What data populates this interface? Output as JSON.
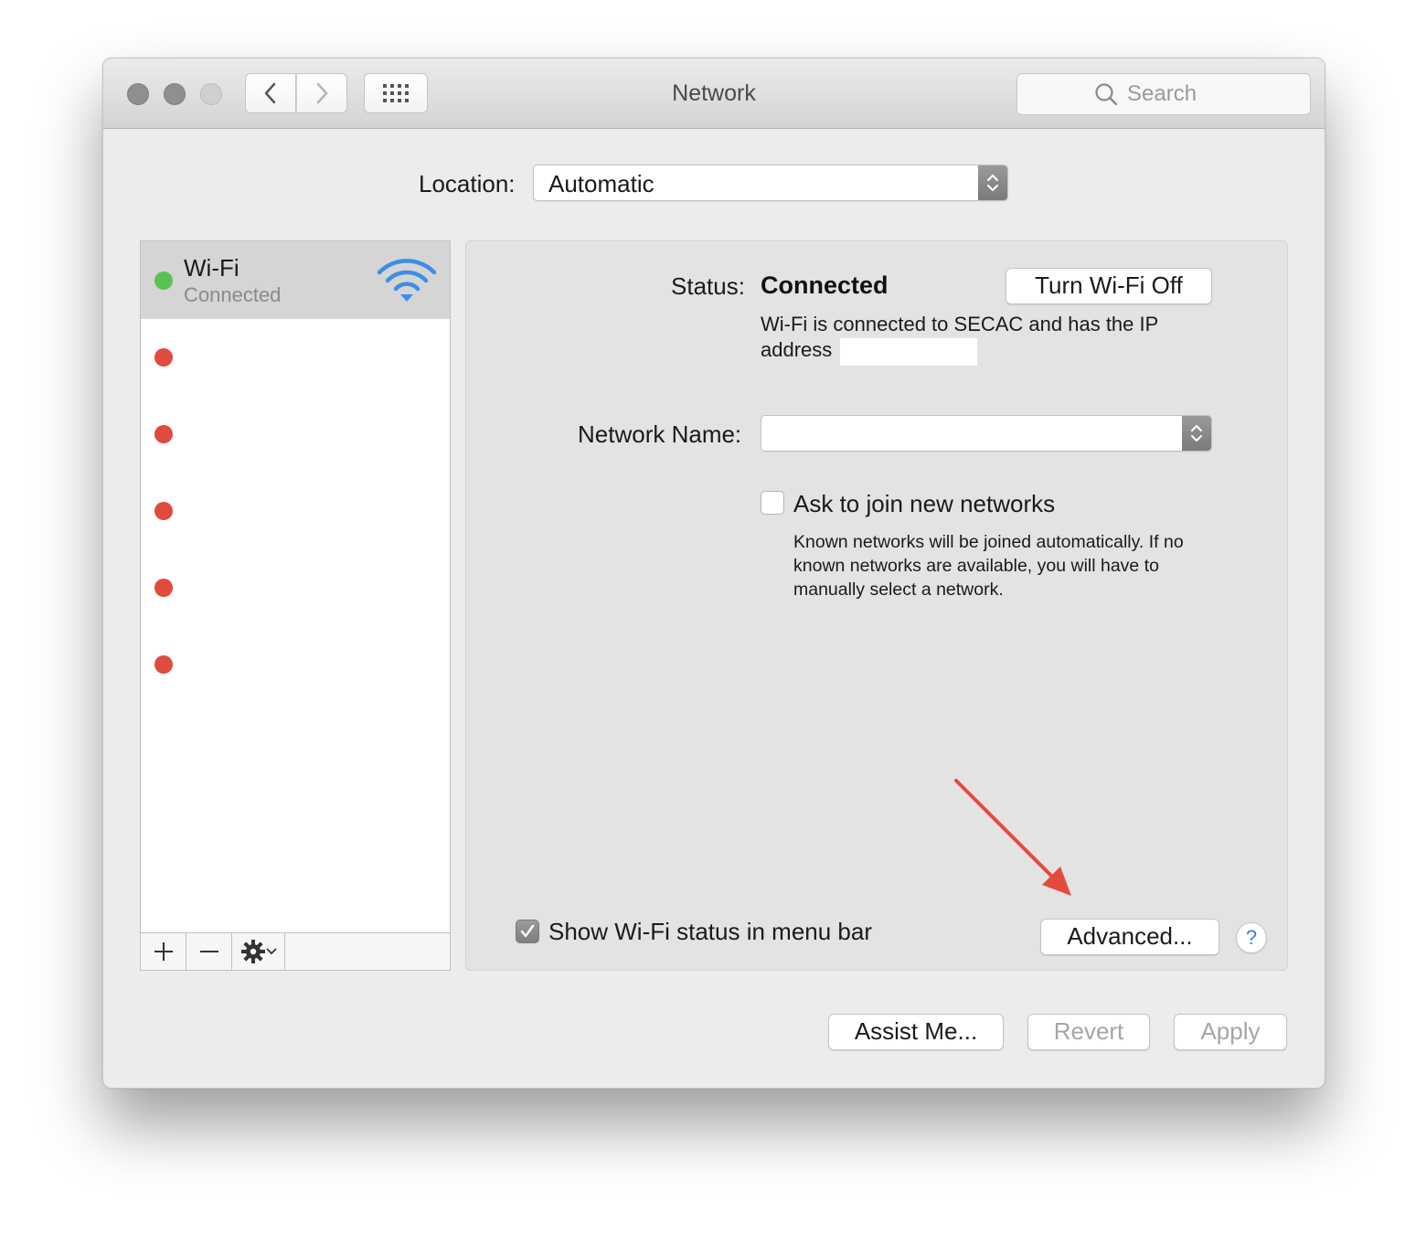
{
  "window": {
    "title": "Network"
  },
  "toolbar": {
    "search_placeholder": "Search",
    "back_icon": "chevron-left-icon",
    "forward_icon": "chevron-right-icon",
    "show_all_icon": "grid-icon"
  },
  "location": {
    "label": "Location:",
    "value": "Automatic"
  },
  "services": {
    "selected": {
      "name": "Wi-Fi",
      "status": "Connected",
      "status_color": "#5ac251"
    },
    "other_status_color": "#e04b3f",
    "other_count_visible": 5
  },
  "sidebar_footer": {
    "add_label": "+",
    "remove_label": "—"
  },
  "detail": {
    "status_label": "Status:",
    "status_value": "Connected",
    "turn_off_label": "Turn Wi-Fi Off",
    "status_description": "Wi-Fi is connected to SECAC and has the IP address",
    "network_name_label": "Network Name:",
    "network_name_value": "",
    "ask_to_join_label": "Ask to join new networks",
    "ask_to_join_checked": false,
    "ask_to_join_description": "Known networks will be joined automatically. If no known networks are available, you will have to manually select a network.",
    "show_status_label": "Show Wi-Fi status in menu bar",
    "show_status_checked": true,
    "advanced_label": "Advanced...",
    "help_label": "?"
  },
  "footer": {
    "assist_label": "Assist Me...",
    "revert_label": "Revert",
    "apply_label": "Apply"
  },
  "annotation": {
    "arrow_color": "#e34b3b"
  }
}
